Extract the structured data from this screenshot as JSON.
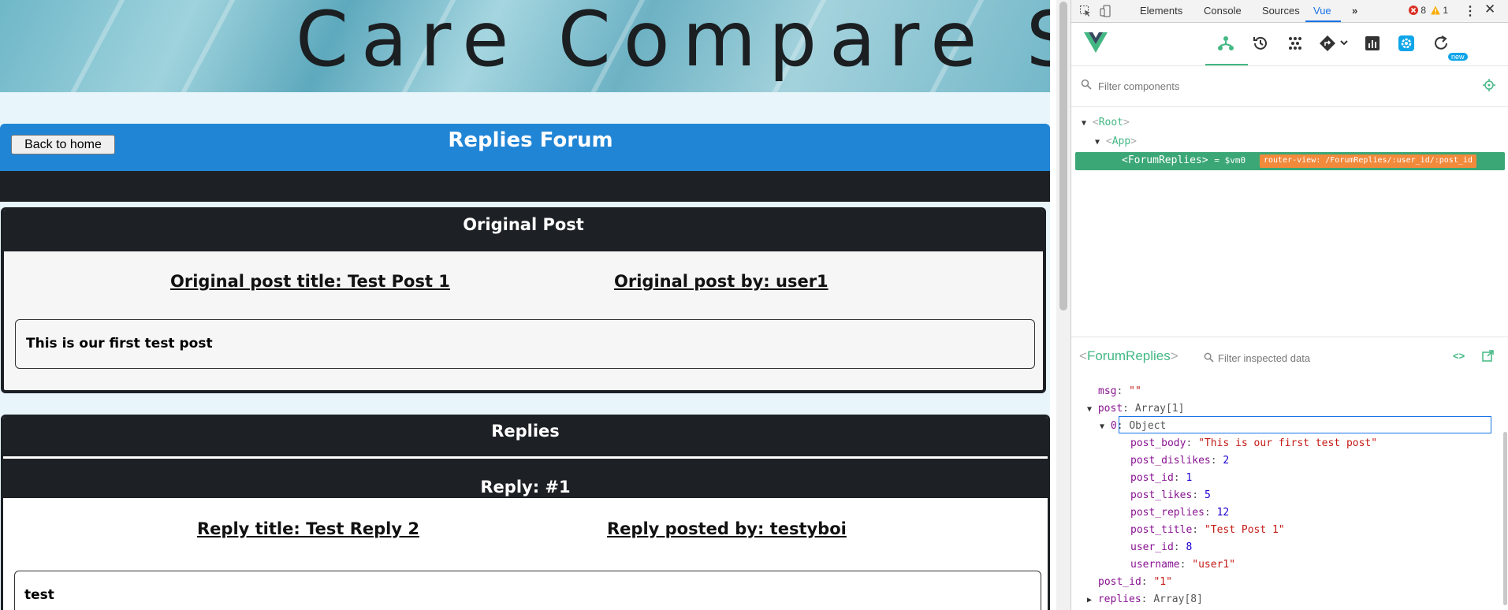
{
  "page": {
    "banner_text": "Care Compare SK",
    "back_button": "Back to home",
    "forum_title": "Replies Forum",
    "original_post_header": "Original Post",
    "original_post_title": "Original post title: Test Post 1",
    "original_post_by": "Original post by: user1",
    "original_post_body": "This is our first test post",
    "replies_header": "Replies",
    "reply_header": "Reply: #1",
    "reply_title": "Reply title: Test Reply 2",
    "reply_posted_by": "Reply posted by: testyboi",
    "reply_body": "test"
  },
  "devtools": {
    "tabs": [
      "Elements",
      "Console",
      "Sources",
      "Vue"
    ],
    "more_tabs": "»",
    "error_count": "8",
    "warning_count": "1",
    "new_badge": "new",
    "filter_placeholder": "Filter components",
    "tree": {
      "root": "Root",
      "app": "App",
      "selected": "ForumReplies",
      "selected_suffix": "= $vm0",
      "router_badge": "router-view: /ForumReplies/:user_id/:post_id"
    },
    "inspector": {
      "component": "ForumReplies",
      "filter_placeholder": "Filter inspected data",
      "props": {
        "msg_key": "msg",
        "msg_val": "\"\"",
        "post_key": "post",
        "post_val": "Array[1]",
        "obj_key": "0",
        "obj_val": "Object",
        "post_body_key": "post_body",
        "post_body_val": "\"This is our first test post\"",
        "post_dislikes_key": "post_dislikes",
        "post_dislikes_val": "2",
        "post_id_key": "post_id",
        "post_id_val": "1",
        "post_likes_key": "post_likes",
        "post_likes_val": "5",
        "post_replies_key": "post_replies",
        "post_replies_val": "12",
        "post_title_key": "post_title",
        "post_title_val": "\"Test Post 1\"",
        "user_id_key": "user_id",
        "user_id_val": "8",
        "username_key": "username",
        "username_val": "\"user1\"",
        "post_id2_key": "post_id",
        "post_id2_val": "\"1\"",
        "replies_key": "replies",
        "replies_val": "Array[8]"
      }
    }
  },
  "colors": {
    "navbar": "#2185d5",
    "dark": "#1d2125",
    "vue_green": "#42b883",
    "router_badge": "#f28a3c"
  }
}
